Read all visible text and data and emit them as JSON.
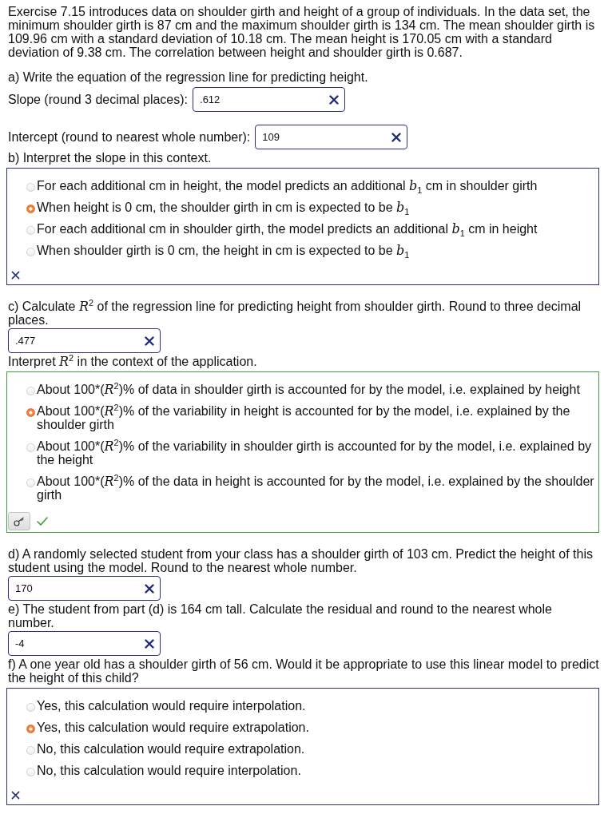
{
  "intro": "Exercise 7.15 introduces data on shoulder girth and height of a group of individuals. In the data set, the minimum shoulder girth is 87 cm and the maximum shoulder girth is 134 cm. The mean shoulder girth is 109.96 cm with a standard deviation of 10.18 cm. The mean height is 170.05 cm with a standard deviation of 9.38 cm. The correlation between height and shoulder girth is 0.687.",
  "parts": [
    {
      "kind": "prompt",
      "text": "a) Write the equation of the regression line for predicting height."
    },
    {
      "kind": "field",
      "label": "Slope (round 3 decimal places):",
      "value": ".612",
      "correct": false
    },
    {
      "kind": "field",
      "label": "Intercept (round to nearest whole number):",
      "value": "109",
      "correct": false
    },
    {
      "kind": "prompt",
      "text": "b) Interpret the slope in this context."
    },
    {
      "kind": "choices",
      "correct": false,
      "answer_key": false,
      "options": [
        {
          "text": "For each additional cm in height, the model predicts an additional 𝑏$_{1}$ cm in shoulder girth",
          "selected": false
        },
        {
          "text": "When height is 0 cm, the shoulder girth in cm is expected to be 𝑏$_{1}$",
          "selected": true
        },
        {
          "text": "For each additional cm in shoulder girth, the model predicts an additional 𝑏$_{1}$ cm in height",
          "selected": false
        },
        {
          "text": "When shoulder girth is 0 cm, the height in cm is expected to be 𝑏$_{1}$",
          "selected": false
        }
      ]
    },
    {
      "kind": "prompt",
      "text": "c) Calculate 𝑅$^{2}$ of the regression line for predicting height from shoulder girth. Round to three decimal places."
    },
    {
      "kind": "field",
      "value": ".477",
      "correct": false
    },
    {
      "kind": "prompt",
      "text": "Interpret 𝑅$^{2}$ in the context of the application."
    },
    {
      "kind": "choices",
      "correct": true,
      "answer_key": true,
      "options": [
        {
          "text": "About 100*(𝑅$^{2}$)% of data in shoulder girth is accounted for by the model, i.e. explained by height",
          "selected": false
        },
        {
          "text": "About 100*(𝑅$^{2}$)% of the variability in height is accounted for by the model, i.e. explained by the shoulder girth",
          "selected": true
        },
        {
          "text": "About 100*(𝑅$^{2}$)% of the variability in shoulder girth is accounted for by the model, i.e. explained by the height",
          "selected": false
        },
        {
          "text": "About 100*(𝑅$^{2}$)% of the data in height is accounted for by the model, i.e. explained by the shoulder girth",
          "selected": false
        }
      ]
    },
    {
      "kind": "prompt",
      "text": "d) A randomly selected student from your class has a shoulder girth of 103 cm. Predict the height of this student using the model. Round to the nearest whole number."
    },
    {
      "kind": "field",
      "value": "170",
      "correct": false
    },
    {
      "kind": "prompt",
      "text": "e) The student from part (d) is 164 cm tall. Calculate the residual and round to the nearest whole number."
    },
    {
      "kind": "field",
      "value": "-4",
      "correct": false
    },
    {
      "kind": "prompt",
      "text": "f) A one year old has a shoulder girth of 56 cm. Would it be appropriate to use this linear model to predict the height of this child?"
    },
    {
      "kind": "choices",
      "correct": false,
      "answer_key": false,
      "options": [
        {
          "text": "Yes, this calculation would require interpolation.",
          "selected": false
        },
        {
          "text": "Yes, this calculation would require extrapolation.",
          "selected": true
        },
        {
          "text": "No, this calculation would require extrapolation.",
          "selected": false
        },
        {
          "text": "No, this calculation would require interpolation.",
          "selected": false
        }
      ]
    }
  ]
}
